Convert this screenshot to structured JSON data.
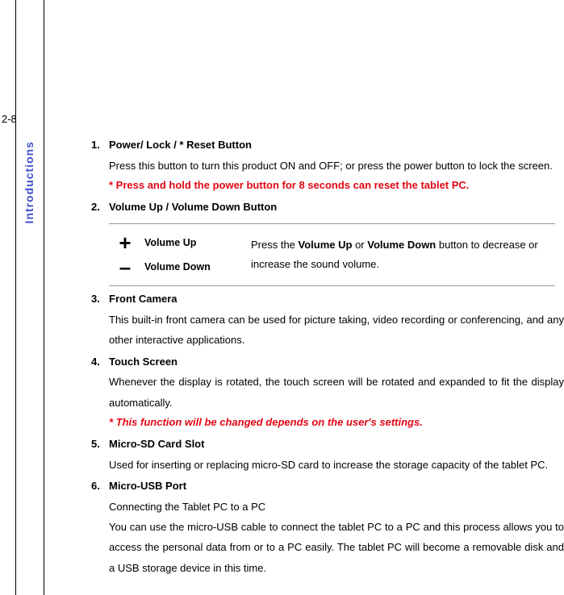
{
  "page_number": "2-8",
  "side_label": "Introductions",
  "items": [
    {
      "title": "Power/ Lock / * Reset Button",
      "body": "Press this button to turn this product ON and OFF; or press the power button to lock the screen.",
      "warn": "* Press and hold the power button for 8 seconds can reset the tablet PC."
    },
    {
      "title": "Volume Up / Volume Down Button",
      "vol_up_icon": "+",
      "vol_up_label": "Volume Up",
      "vol_down_icon": "–",
      "vol_down_label": "Volume Down",
      "vol_desc_pre": "Press the ",
      "vol_desc_b1": "Volume Up",
      "vol_desc_mid": " or ",
      "vol_desc_b2": "Volume Down",
      "vol_desc_post": " button to decrease or increase the sound volume."
    },
    {
      "title": "Front Camera",
      "body": "This built-in front camera can be used for picture taking, video recording or conferencing, and any other interactive applications."
    },
    {
      "title": "Touch Screen",
      "body": "Whenever the display is rotated, the touch screen will be rotated and expanded to fit the display automatically.",
      "warn_italic": "* This function will be changed depends on the user's settings."
    },
    {
      "title": "Micro-SD Card Slot",
      "body": "Used for inserting or replacing micro-SD card to increase the storage capacity of the tablet PC."
    },
    {
      "title": "Micro-USB Port",
      "body": "Connecting the Tablet PC to a PC",
      "body2": "You can use the micro-USB cable to connect the tablet PC to a PC and this process allows you to access the personal data from or to a PC easily. The tablet PC will become a removable disk and a USB storage device in this time."
    }
  ]
}
